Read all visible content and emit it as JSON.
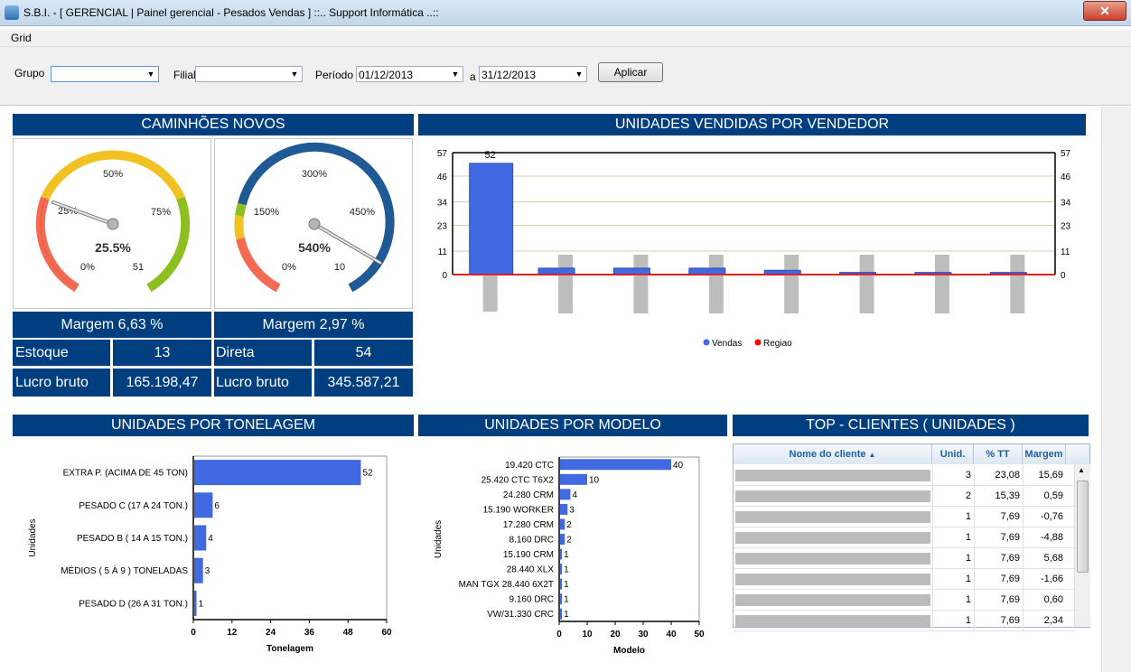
{
  "window": {
    "title": "S.B.I. - [ GERENCIAL | Painel gerencial - Pesados Vendas ] ::.. Support Informática ..::",
    "close": "✕"
  },
  "menu": {
    "grid": "Grid"
  },
  "filters": {
    "grupo_label": "Grupo",
    "grupo_value": "",
    "filial_label": "Filial",
    "filial_value": "",
    "periodo_label": "Período",
    "periodo_start": "01/12/2013",
    "a_label": "a",
    "periodo_end": "31/12/2013",
    "apply": "Aplicar"
  },
  "caminhoes": {
    "title": "CAMINHÕES NOVOS",
    "gauge1": {
      "t0": "0%",
      "t25": "25%",
      "t50": "50%",
      "t75": "75%",
      "tmax": "51",
      "value_label": "25.5%",
      "value_pct": 25.5
    },
    "gauge2": {
      "t0": "0%",
      "t150": "150%",
      "t300": "300%",
      "t450": "450%",
      "tmax": "10",
      "value_label": "540%",
      "value_pct": 540
    },
    "margem1": "Margem 6,63 %",
    "margem2": "Margem 2,97 %",
    "estoque_label": "Estoque",
    "estoque_value": "13",
    "direta_label": "Direta",
    "direta_value": "54",
    "lucro_label": "Lucro bruto",
    "lucro1": "165.198,47",
    "lucro2": "345.587,21"
  },
  "colors": {
    "header": "#003f7f",
    "bar": "#4169e1",
    "gray_bar": "#bdbdbd",
    "regiao": "#ff0000"
  },
  "chart_data": [
    {
      "type": "bar",
      "title": "UNIDADES VENDIDAS POR VENDEDOR",
      "yticks": [
        "0",
        "11",
        "23",
        "34",
        "46",
        "57"
      ],
      "ylim": [
        0,
        57
      ],
      "top_label": "52",
      "series": [
        {
          "name": "Vendas",
          "values": [
            52,
            3,
            3,
            3,
            2,
            1,
            1,
            1
          ]
        },
        {
          "name": "Regiao",
          "values": [
            0,
            0,
            0,
            0,
            0,
            0,
            0,
            0
          ]
        }
      ],
      "legend_position": "bottom"
    },
    {
      "type": "bar",
      "title": "UNIDADES POR TONELAGEM",
      "categories": [
        "EXTRA P. (ACIMA DE 45 TON)",
        "PESADO C (17 A 24 TON.)",
        "PESADO B ( 14 A 15 TON.)",
        "MÉDIOS ( 5 À  9 )  TONELADAS",
        "PESADO D (26 A 31 TON.)"
      ],
      "values": [
        52,
        6,
        4,
        3,
        1
      ],
      "xticks": [
        "0",
        "12",
        "24",
        "36",
        "48",
        "60"
      ],
      "xlim": [
        0,
        60
      ],
      "xlabel": "Tonelagem",
      "ylabel": "Unidades"
    },
    {
      "type": "bar",
      "title": "UNIDADES POR MODELO",
      "categories": [
        "19.420 CTC",
        "25.420 CTC T6X2",
        "24.280 CRM",
        "15.190 WORKER",
        "17.280 CRM",
        "8.160 DRC",
        "15.190 CRM",
        "28.440 XLX",
        "MAN TGX 28.440 6X2T",
        "9.160 DRC",
        "VW/31.330 CRC"
      ],
      "values": [
        40,
        10,
        4,
        3,
        2,
        2,
        1,
        1,
        1,
        1,
        1
      ],
      "xticks": [
        "0",
        "10",
        "20",
        "30",
        "40",
        "50"
      ],
      "xlim": [
        0,
        50
      ],
      "xlabel": "Modelo",
      "ylabel": "Unidades"
    }
  ],
  "clientes": {
    "title": "TOP - CLIENTES ( UNIDADES )",
    "columns": [
      "Nome do cliente",
      "Unid.",
      "% TT",
      "Margem"
    ],
    "rows": [
      {
        "unid": "3",
        "pct": "23,08",
        "margem": "15,69"
      },
      {
        "unid": "2",
        "pct": "15,39",
        "margem": "0,59"
      },
      {
        "unid": "1",
        "pct": "7,69",
        "margem": "-0,76"
      },
      {
        "unid": "1",
        "pct": "7,69",
        "margem": "-4,88"
      },
      {
        "unid": "1",
        "pct": "7,69",
        "margem": "5,68"
      },
      {
        "unid": "1",
        "pct": "7,69",
        "margem": "-1,66"
      },
      {
        "unid": "1",
        "pct": "7,69",
        "margem": "0,60"
      },
      {
        "unid": "1",
        "pct": "7,69",
        "margem": "2,34"
      }
    ]
  }
}
